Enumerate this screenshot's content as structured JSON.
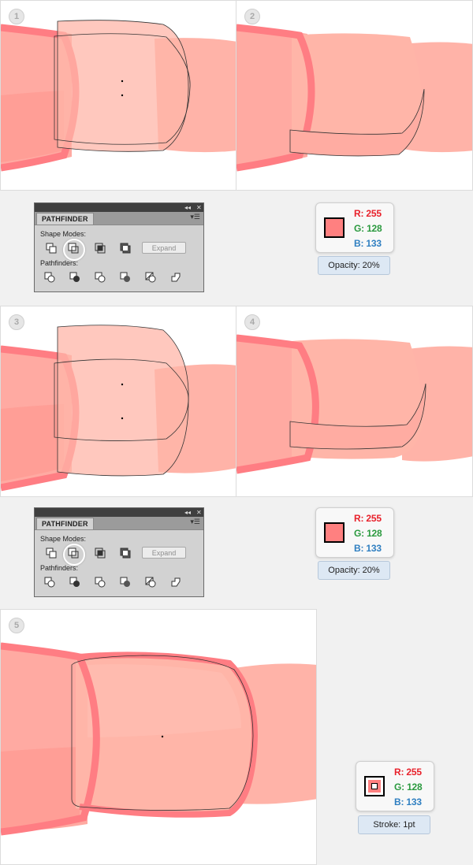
{
  "steps": [
    "1",
    "2",
    "3",
    "4",
    "5"
  ],
  "pathfinder": {
    "title": "PATHFINDER",
    "shape_modes_label": "Shape Modes:",
    "pathfinders_label": "Pathfinders:",
    "expand_label": "Expand",
    "collapse_icon": "double-arrow-left-icon",
    "close_icon": "close-icon",
    "menu_icon": "panel-menu-icon"
  },
  "color": {
    "r": "R: 255",
    "g": "G: 128",
    "b": "B: 133",
    "hex": "#ff8080"
  },
  "notes": {
    "opacity": "Opacity: 20%",
    "stroke": "Stroke: 1pt"
  }
}
